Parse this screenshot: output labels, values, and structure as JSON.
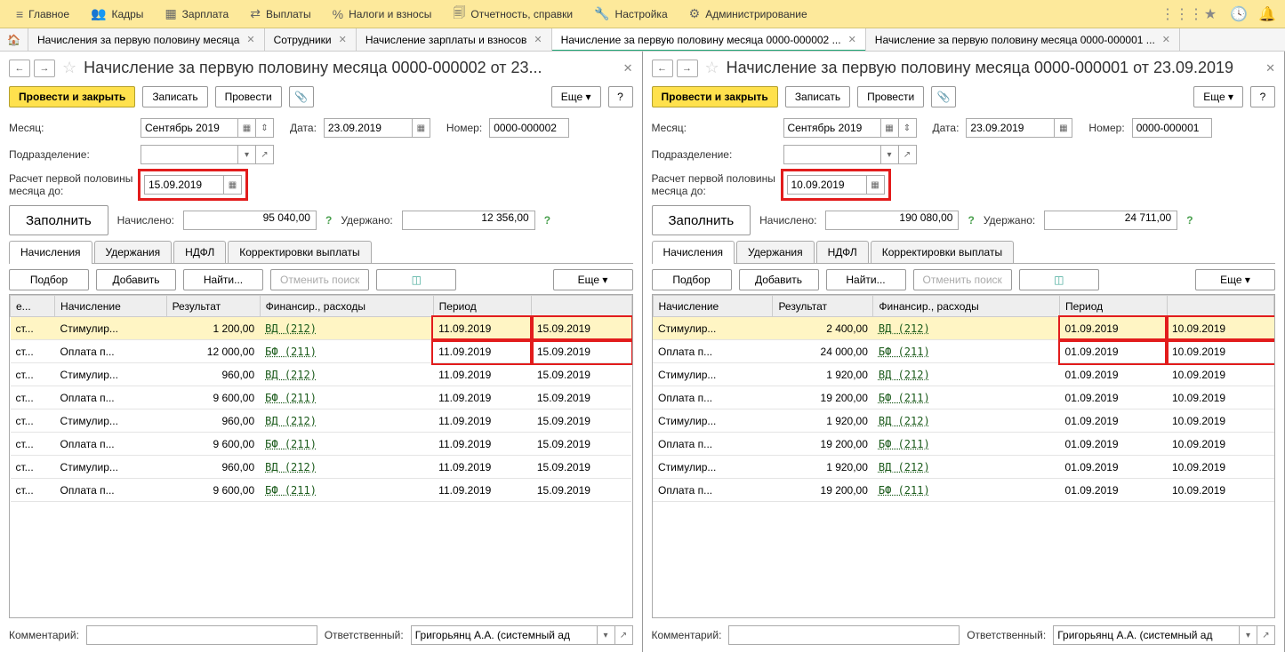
{
  "menubar": {
    "items": [
      {
        "icon": "≡",
        "label": "Главное"
      },
      {
        "icon": "👥",
        "label": "Кадры"
      },
      {
        "icon": "▦",
        "label": "Зарплата"
      },
      {
        "icon": "⇄",
        "label": "Выплаты"
      },
      {
        "icon": "%",
        "label": "Налоги и взносы"
      },
      {
        "icon": "🗐",
        "label": "Отчетность, справки"
      },
      {
        "icon": "🔧",
        "label": "Настройка"
      },
      {
        "icon": "⚙",
        "label": "Администрирование"
      }
    ]
  },
  "tabs": [
    {
      "label": "Начисления за первую половину месяца",
      "active": false
    },
    {
      "label": "Сотрудники",
      "active": false
    },
    {
      "label": "Начисление зарплаты и взносов",
      "active": false
    },
    {
      "label": "Начисление за первую половину месяца 0000-000002 ...",
      "active": true
    },
    {
      "label": "Начисление за первую половину месяца 0000-000001 ...",
      "active": false
    }
  ],
  "left": {
    "title": "Начисление за первую половину месяца 0000-000002 от 23...",
    "toolbar": {
      "post_close": "Провести и закрыть",
      "write": "Записать",
      "post": "Провести",
      "more": "Еще"
    },
    "month_label": "Месяц:",
    "month": "Сентябрь 2019",
    "date_label": "Дата:",
    "date": "23.09.2019",
    "number_label": "Номер:",
    "number": "0000-000002",
    "dept_label": "Подразделение:",
    "calc_label": "Расчет первой половины месяца до:",
    "calc_date": "15.09.2019",
    "fill": "Заполнить",
    "accrued_label": "Начислено:",
    "accrued": "95 040,00",
    "withheld_label": "Удержано:",
    "withheld": "12 356,00",
    "subtabs": [
      "Начисления",
      "Удержания",
      "НДФЛ",
      "Корректировки выплаты"
    ],
    "tbl_toolbar": {
      "select": "Подбор",
      "add": "Добавить",
      "find": "Найти...",
      "cancel_find": "Отменить поиск",
      "more": "Еще"
    },
    "columns": [
      "е...",
      "Начисление",
      "Результат",
      "Финансир., расходы",
      "Период",
      ""
    ],
    "rows": [
      {
        "c0": "ст...",
        "name": "Стимулир...",
        "res": "1 200,00",
        "fin": "ВД (212)",
        "p1": "11.09.2019",
        "p2": "15.09.2019",
        "sel": true,
        "hl": true
      },
      {
        "c0": "ст...",
        "name": "Оплата п...",
        "res": "12 000,00",
        "fin": "БФ (211)",
        "p1": "11.09.2019",
        "p2": "15.09.2019",
        "hl": true
      },
      {
        "c0": "ст...",
        "name": "Стимулир...",
        "res": "960,00",
        "fin": "ВД (212)",
        "p1": "11.09.2019",
        "p2": "15.09.2019"
      },
      {
        "c0": "ст...",
        "name": "Оплата п...",
        "res": "9 600,00",
        "fin": "БФ (211)",
        "p1": "11.09.2019",
        "p2": "15.09.2019"
      },
      {
        "c0": "ст...",
        "name": "Стимулир...",
        "res": "960,00",
        "fin": "ВД (212)",
        "p1": "11.09.2019",
        "p2": "15.09.2019"
      },
      {
        "c0": "ст...",
        "name": "Оплата п...",
        "res": "9 600,00",
        "fin": "БФ (211)",
        "p1": "11.09.2019",
        "p2": "15.09.2019"
      },
      {
        "c0": "ст...",
        "name": "Стимулир...",
        "res": "960,00",
        "fin": "ВД (212)",
        "p1": "11.09.2019",
        "p2": "15.09.2019"
      },
      {
        "c0": "ст...",
        "name": "Оплата п...",
        "res": "9 600,00",
        "fin": "БФ (211)",
        "p1": "11.09.2019",
        "p2": "15.09.2019"
      }
    ],
    "comment_label": "Комментарий:",
    "resp_label": "Ответственный:",
    "resp": "Григорьянц А.А. (системный ад"
  },
  "right": {
    "title": "Начисление за первую половину месяца 0000-000001 от 23.09.2019",
    "toolbar": {
      "post_close": "Провести и закрыть",
      "write": "Записать",
      "post": "Провести",
      "more": "Еще"
    },
    "month_label": "Месяц:",
    "month": "Сентябрь 2019",
    "date_label": "Дата:",
    "date": "23.09.2019",
    "number_label": "Номер:",
    "number": "0000-000001",
    "dept_label": "Подразделение:",
    "calc_label": "Расчет первой половины месяца до:",
    "calc_date": "10.09.2019",
    "fill": "Заполнить",
    "accrued_label": "Начислено:",
    "accrued": "190 080,00",
    "withheld_label": "Удержано:",
    "withheld": "24 711,00",
    "subtabs": [
      "Начисления",
      "Удержания",
      "НДФЛ",
      "Корректировки выплаты"
    ],
    "tbl_toolbar": {
      "select": "Подбор",
      "add": "Добавить",
      "find": "Найти...",
      "cancel_find": "Отменить поиск",
      "more": "Еще"
    },
    "columns": [
      "Начисление",
      "Результат",
      "Финансир., расходы",
      "Период",
      ""
    ],
    "rows": [
      {
        "name": "Стимулир...",
        "res": "2 400,00",
        "fin": "ВД (212)",
        "p1": "01.09.2019",
        "p2": "10.09.2019",
        "sel": true,
        "hl": true
      },
      {
        "name": "Оплата п...",
        "res": "24 000,00",
        "fin": "БФ (211)",
        "p1": "01.09.2019",
        "p2": "10.09.2019",
        "hl": true
      },
      {
        "name": "Стимулир...",
        "res": "1 920,00",
        "fin": "ВД (212)",
        "p1": "01.09.2019",
        "p2": "10.09.2019"
      },
      {
        "name": "Оплата п...",
        "res": "19 200,00",
        "fin": "БФ (211)",
        "p1": "01.09.2019",
        "p2": "10.09.2019"
      },
      {
        "name": "Стимулир...",
        "res": "1 920,00",
        "fin": "ВД (212)",
        "p1": "01.09.2019",
        "p2": "10.09.2019"
      },
      {
        "name": "Оплата п...",
        "res": "19 200,00",
        "fin": "БФ (211)",
        "p1": "01.09.2019",
        "p2": "10.09.2019"
      },
      {
        "name": "Стимулир...",
        "res": "1 920,00",
        "fin": "ВД (212)",
        "p1": "01.09.2019",
        "p2": "10.09.2019"
      },
      {
        "name": "Оплата п...",
        "res": "19 200,00",
        "fin": "БФ (211)",
        "p1": "01.09.2019",
        "p2": "10.09.2019"
      }
    ],
    "comment_label": "Комментарий:",
    "resp_label": "Ответственный:",
    "resp": "Григорьянц А.А. (системный ад"
  }
}
